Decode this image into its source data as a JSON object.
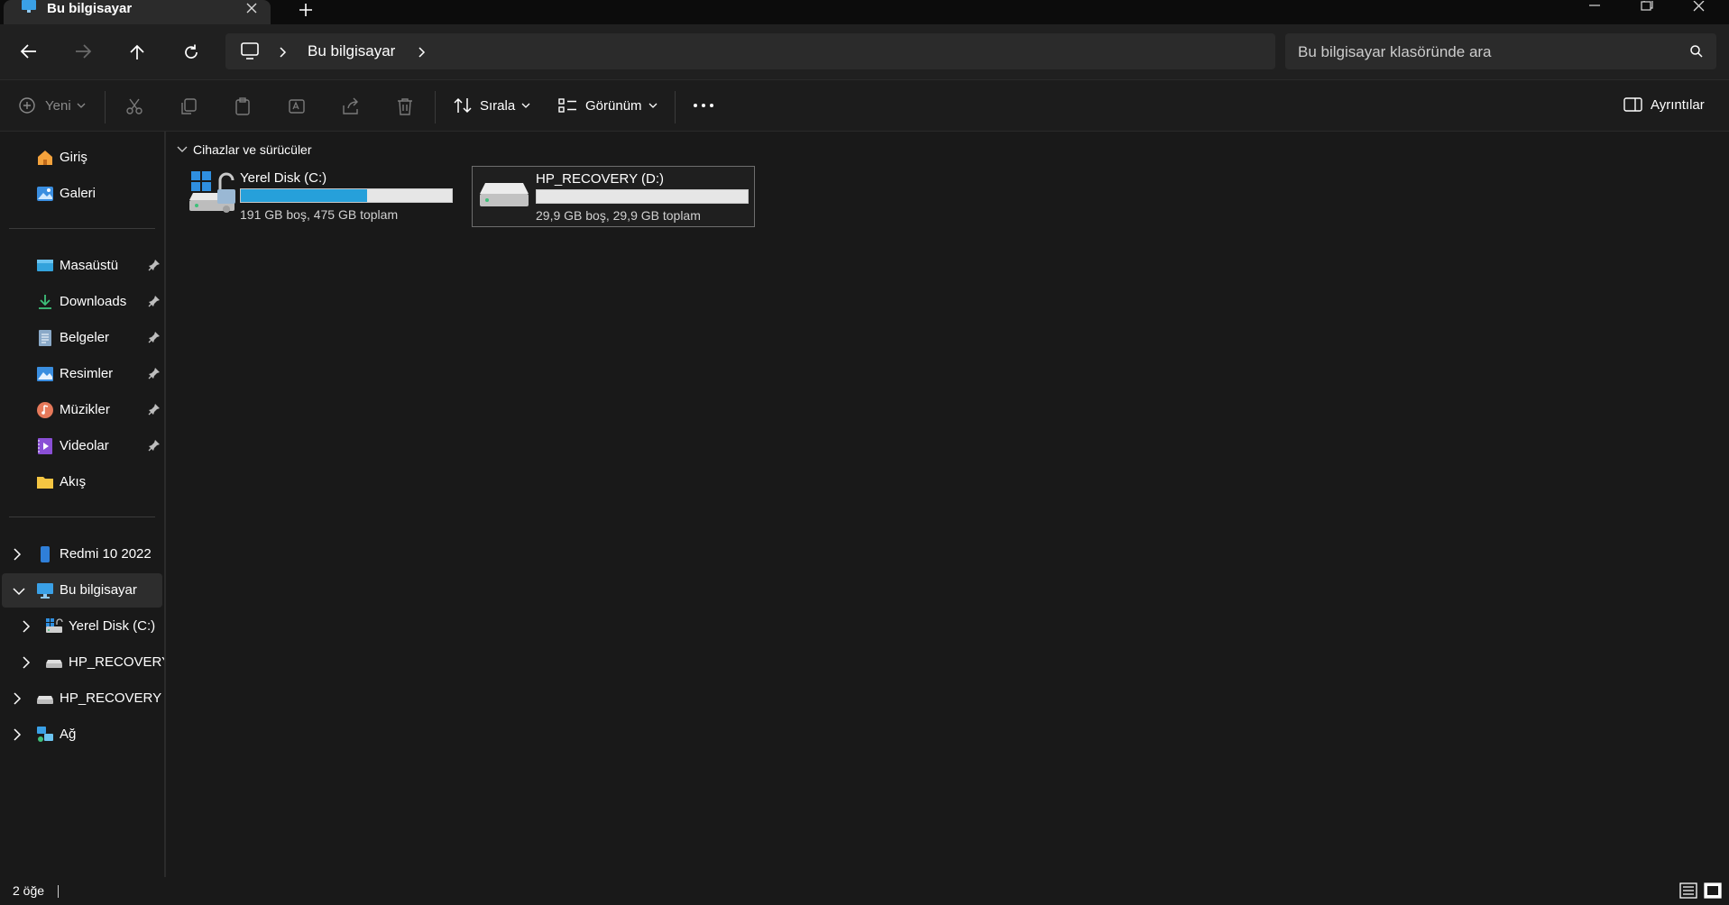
{
  "tab": {
    "title": "Bu bilgisayar",
    "icon": "monitor-icon"
  },
  "nav": {
    "back": "arrow-left-icon",
    "forward": "arrow-right-icon",
    "up": "arrow-up-icon",
    "refresh": "refresh-icon",
    "address": "Bu bilgisayar",
    "search_placeholder": "Bu bilgisayar klasöründe ara"
  },
  "toolbar": {
    "new_label": "Yeni",
    "sort_label": "Sırala",
    "view_label": "Görünüm",
    "details_label": "Ayrıntılar",
    "actions": [
      "cut-icon",
      "copy-icon",
      "paste-icon",
      "rename-icon",
      "share-icon",
      "delete-icon"
    ]
  },
  "sidebar": {
    "quick": [
      {
        "label": "Giriş",
        "icon": "home-icon"
      },
      {
        "label": "Galeri",
        "icon": "gallery-icon"
      }
    ],
    "pinned": [
      {
        "label": "Masaüstü",
        "icon": "desktop-icon",
        "pinned": true
      },
      {
        "label": "Downloads",
        "icon": "download-icon",
        "pinned": true
      },
      {
        "label": "Belgeler",
        "icon": "documents-icon",
        "pinned": true
      },
      {
        "label": "Resimler",
        "icon": "pictures-icon",
        "pinned": true
      },
      {
        "label": "Müzikler",
        "icon": "music-icon",
        "pinned": true
      },
      {
        "label": "Videolar",
        "icon": "videos-icon",
        "pinned": true
      },
      {
        "label": "Akış",
        "icon": "folder-icon",
        "pinned": false
      }
    ],
    "tree": [
      {
        "label": "Redmi 10 2022",
        "icon": "phone-icon",
        "expanded": false,
        "level": 0
      },
      {
        "label": "Bu bilgisayar",
        "icon": "monitor-icon",
        "expanded": true,
        "level": 0,
        "selected": true
      },
      {
        "label": "Yerel Disk (C:)",
        "icon": "system-drive-icon",
        "expanded": false,
        "level": 1
      },
      {
        "label": "HP_RECOVERY (",
        "icon": "drive-icon",
        "expanded": false,
        "level": 1
      },
      {
        "label": "HP_RECOVERY (D",
        "icon": "drive-icon",
        "expanded": false,
        "level": 0
      },
      {
        "label": "Ağ",
        "icon": "network-icon",
        "expanded": false,
        "level": 0
      }
    ]
  },
  "content": {
    "group_title": "Cihazlar ve sürücüler",
    "drives": [
      {
        "name": "Yerel Disk (C:)",
        "info": "191 GB boş, 475 GB toplam",
        "used_fraction": 0.598,
        "selected": false,
        "icon": "system-drive-icon"
      },
      {
        "name": "HP_RECOVERY (D:)",
        "info": "29,9 GB boş, 29,9 GB toplam",
        "used_fraction": 0.0,
        "selected": true,
        "icon": "drive-icon"
      }
    ]
  },
  "status": {
    "count": "2 öğe"
  },
  "colors": {
    "accent": "#26a0da",
    "background": "#191919"
  }
}
